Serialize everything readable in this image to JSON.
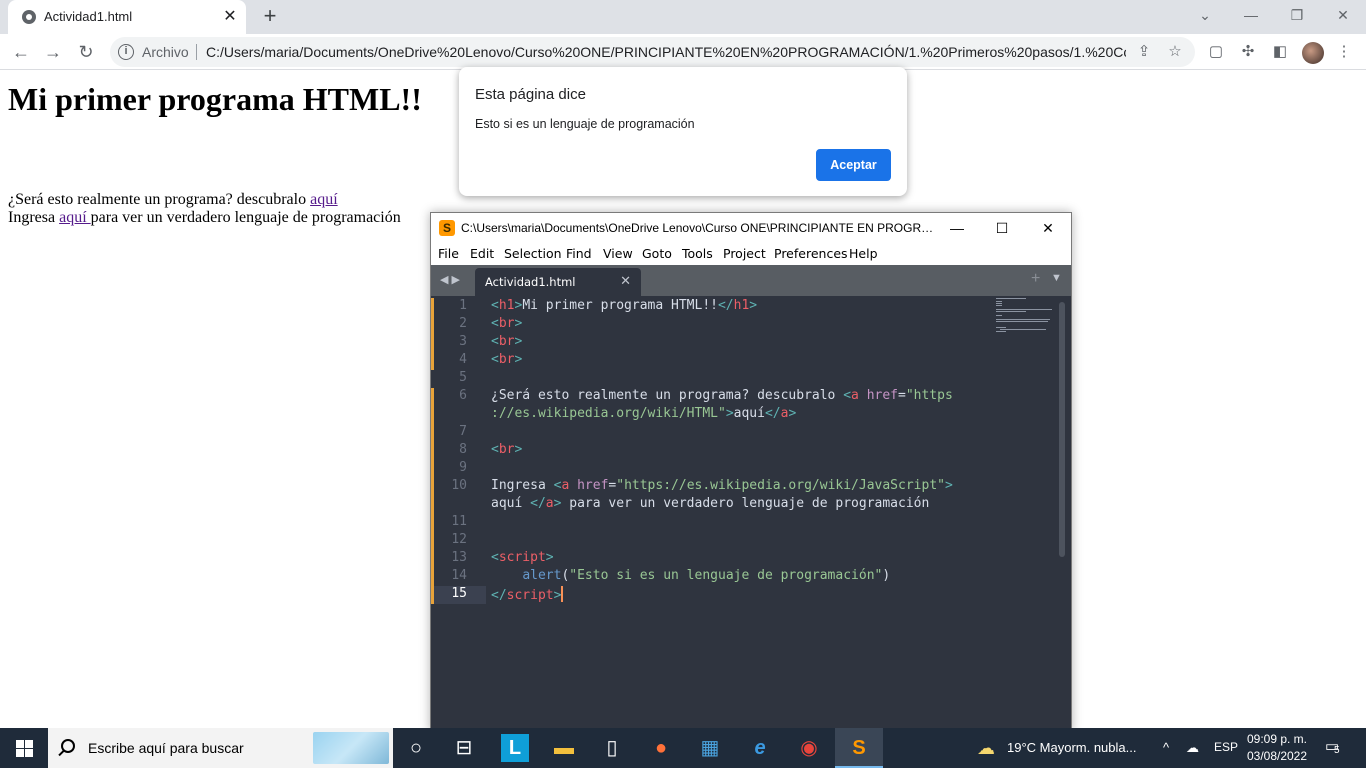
{
  "browser": {
    "tab_title": "Actividad1.html",
    "tab_close": "✕",
    "new_tab": "+",
    "scheme_label": "Archivo",
    "url": "C:/Users/maria/Documents/OneDrive%20Lenovo/Curso%20ONE/PRINCIPIANTE%20EN%20PROGRAMACIÓN/1.%20Primeros%20pasos/1.%20Comi..."
  },
  "page": {
    "heading": "Mi primer programa HTML!!",
    "line1_text": "¿Será esto realmente un programa? descubralo ",
    "line1_link": "aquí",
    "line2_text_before": "Ingresa ",
    "line2_link": "aquí ",
    "line2_text_after": "para ver un verdadero lenguaje de programación"
  },
  "alert": {
    "heading": "Esta página dice",
    "message": "Esto si es un lenguaje de programación",
    "ok_label": "Aceptar"
  },
  "sublime": {
    "window_title": "C:\\Users\\maria\\Documents\\OneDrive Lenovo\\Curso ONE\\PRINCIPIANTE EN PROGRAM...",
    "menu": [
      "File",
      "Edit",
      "Selection",
      "Find",
      "View",
      "Goto",
      "Tools",
      "Project",
      "Preferences",
      "Help"
    ],
    "tab_name": "Actividad1.html",
    "line_numbers": [
      "1",
      "2",
      "3",
      "4",
      "5",
      "6",
      "",
      "7",
      "8",
      "9",
      "10",
      "",
      "11",
      "12",
      "13",
      "14",
      "15"
    ],
    "active_line": "15"
  },
  "taskbar": {
    "search_placeholder": "Escribe aquí para buscar",
    "weather": "19°C  Mayorm. nubla...",
    "language": "ESP",
    "time": "09:09 p. m.",
    "date": "03/08/2022",
    "notifications": "5"
  }
}
